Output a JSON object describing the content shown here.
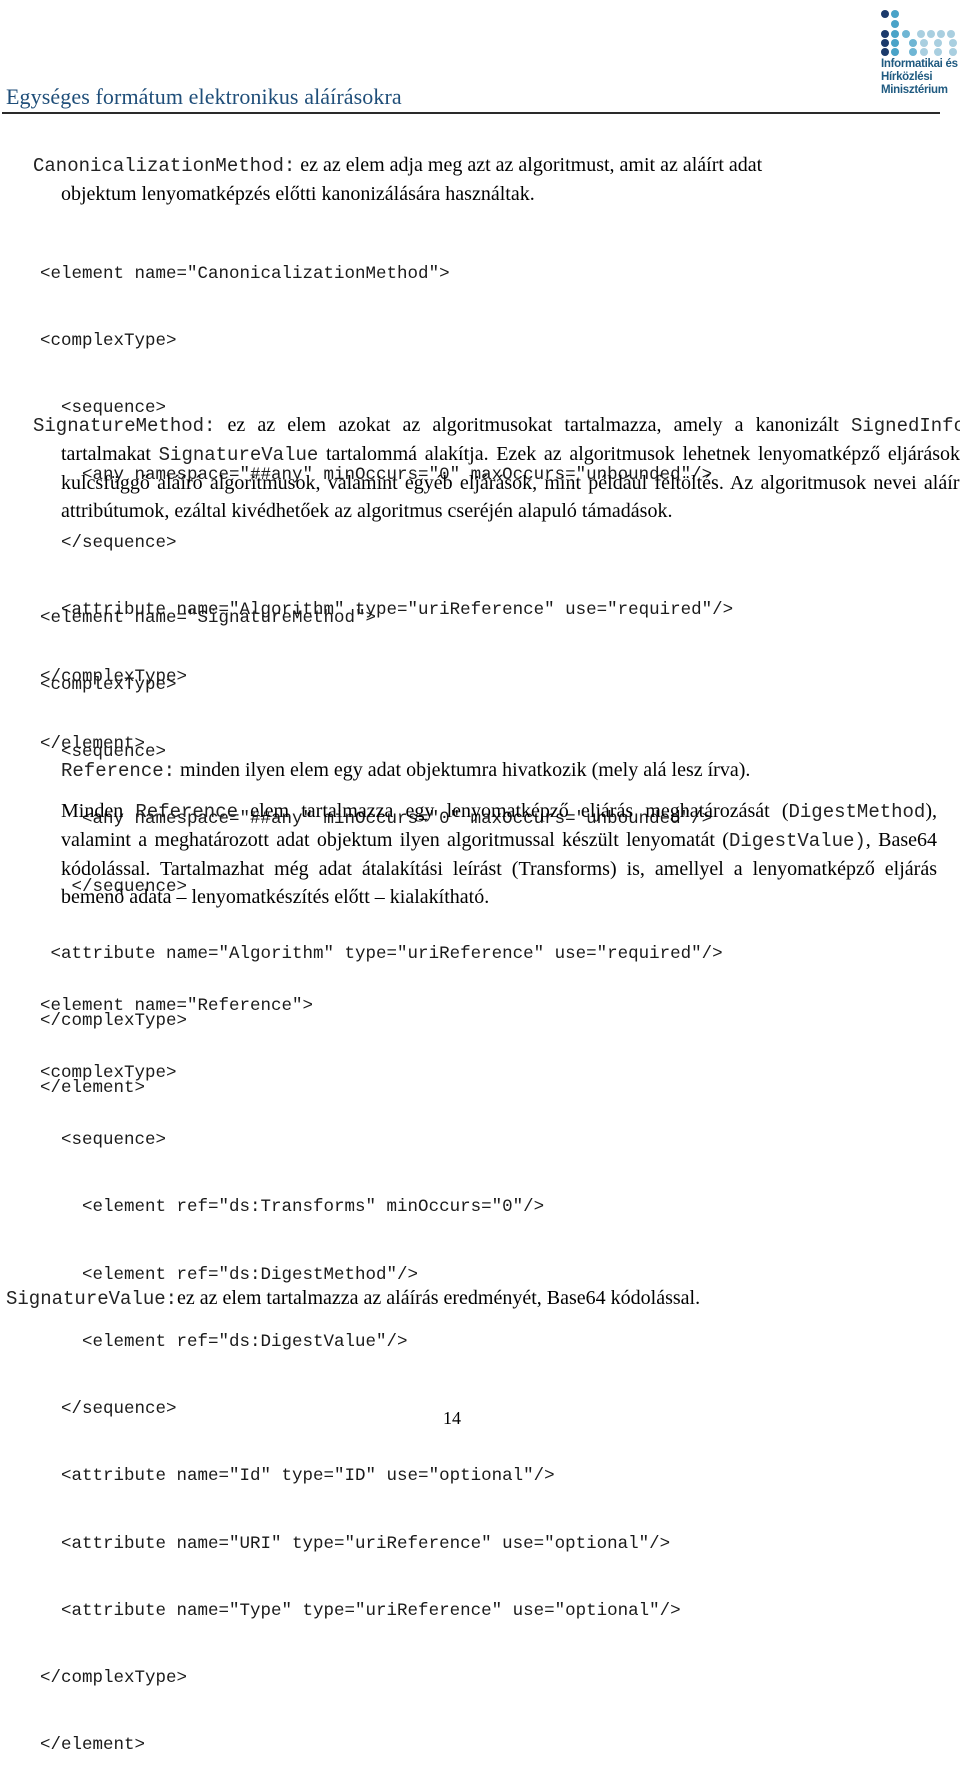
{
  "header": {
    "title": "Egységes formátum elektronikus aláírásokra",
    "logo": {
      "icon": "ministry-dot-grid-logo",
      "lines": [
        "Informatikai és",
        "Hírközlési",
        "Minisztérium"
      ],
      "colors": {
        "dark": "#1b3a6b",
        "medium": "#4aa3c8",
        "light": "#a9cfe0"
      }
    }
  },
  "sections": {
    "canonicalization": {
      "term": "CanonicalizationMethod:",
      "text_line1": " ez az elem adja meg azt az algoritmust, amit az aláírt adat",
      "text_line2": "objektum lenyomatképzés előtti kanonizálására használtak.",
      "code": [
        "<element name=\"CanonicalizationMethod\">",
        "<complexType>",
        "  <sequence>",
        "    <any namespace=\"##any\" minOccurs=\"0\" maxOccurs=\"unbounded\"/>",
        "  </sequence>",
        "  <attribute name=\"Algorithm\" type=\"uriReference\" use=\"required\"/>",
        "</complexType>",
        "</element>"
      ]
    },
    "signature_method": {
      "term": "SignatureMethod:",
      "text_a": " ez az elem azokat az algoritmusokat tartalmazza, amely a kanonizált ",
      "code_signedinfo": "SignedInfo",
      "text_b": " tartalmakat ",
      "code_signaturevalue": "SignatureValue",
      "text_c": " tartalommá alakítja. Ezek az algoritmusok lehetnek lenyomatképző eljárások, kulcsfüggő aláíró algoritmusok, valamint egyéb eljárások, mint például feltöltés. Az algoritmusok nevei aláírt attribútumok, ezáltal kivédhetőek az algoritmus cseréjén alapuló támadások.",
      "code": [
        "<element name=\"SignatureMethod\">",
        "<complexType>",
        "  <sequence>",
        "    <any namespace=\"##any\" minOccurs=\"0\" maxOccurs=\"unbounded\"/>",
        "   </sequence>",
        " <attribute name=\"Algorithm\" type=\"uriReference\" use=\"required\"/>",
        "</complexType>",
        "</element>"
      ]
    },
    "reference": {
      "term": "Reference:",
      "text": "  minden ilyen elem egy adat objektumra hivatkozik (mely alá lesz írva).",
      "para2_a": "Minden ",
      "para2_code_reference": "Reference",
      "para2_b": " elem tartalmazza egy lenyomatképző eljárás meghatározását (",
      "para2_code_digestmethod": "DigestMethod",
      "para2_c": "), valamint a meghatározott adat objektum ilyen algoritmussal készült lenyomatát (",
      "para2_code_digestvalue": "DigestValue)",
      "para2_d": ", Base64 kódolással. Tartalmazhat még adat átalakítási leírást (Transforms) is, amellyel a lenyomatképző eljárás bemenő adata – lenyomatkészítés előtt – kialakítható.",
      "code": [
        "<element name=\"Reference\">",
        "<complexType>",
        "  <sequence>",
        "    <element ref=\"ds:Transforms\" minOccurs=\"0\"/>",
        "    <element ref=\"ds:DigestMethod\"/>",
        "    <element ref=\"ds:DigestValue\"/>",
        "  </sequence>",
        "  <attribute name=\"Id\" type=\"ID\" use=\"optional\"/>",
        "  <attribute name=\"URI\" type=\"uriReference\" use=\"optional\"/>",
        "  <attribute name=\"Type\" type=\"uriReference\" use=\"optional\"/>",
        "</complexType>",
        "</element>"
      ]
    },
    "signature_value": {
      "term": "SignatureValue:",
      "text": "ez az elem tartalmazza az aláírás eredményét, Base64 kódolással."
    }
  },
  "footer": {
    "page_number": "14"
  }
}
